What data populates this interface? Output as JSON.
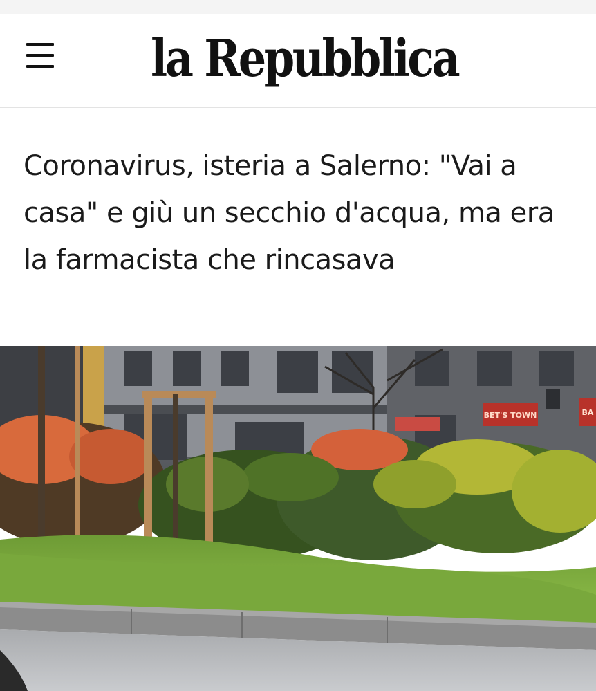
{
  "header": {
    "menu_icon": "hamburger-menu-icon",
    "logo_text": "la Repubblica"
  },
  "article": {
    "headline": "Coronavirus, isteria a Salerno: \"Vai a casa\" e giù un secchio d'acqua, ma era la farmacista che rincasava"
  },
  "photo": {
    "shop_sign_text": "BET'S TOWN",
    "partial_sign_text": "BA",
    "colors": {
      "building": "#6b6d72",
      "hedge": "#3e5a2a",
      "grass": "#7fae3f",
      "curb": "#8c8c8c",
      "road": "#b9bbbe",
      "red_sign": "#b8322a"
    }
  }
}
